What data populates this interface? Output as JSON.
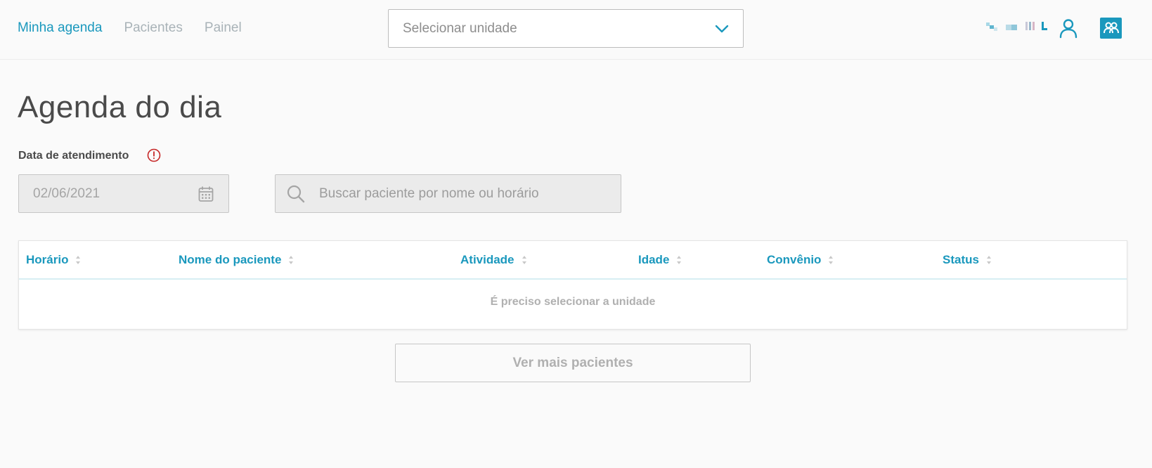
{
  "header": {
    "nav": [
      {
        "label": "Minha agenda",
        "active": true
      },
      {
        "label": "Pacientes",
        "active": false
      },
      {
        "label": "Painel",
        "active": false
      }
    ],
    "unit_select": {
      "placeholder": "Selecionar unidade",
      "icon": "chevron-down-icon"
    },
    "brand_mark_icon": "brand-logo-icon",
    "user_icon": "user-icon",
    "team_icon": "team-icon"
  },
  "main": {
    "title": "Agenda do dia",
    "date_label": "Data de atendimento",
    "date_value": "02/06/2021",
    "search_placeholder": "Buscar paciente por nome ou horário",
    "table": {
      "columns": [
        "Horário",
        "Nome do paciente",
        "Atividade",
        "Idade",
        "Convênio",
        "Status"
      ],
      "empty_message": "É preciso selecionar a unidade"
    },
    "more_button": "Ver mais pacientes"
  },
  "colors": {
    "accent": "#1a98bd",
    "warning": "#c62828",
    "muted_text": "#a9b3b8"
  }
}
